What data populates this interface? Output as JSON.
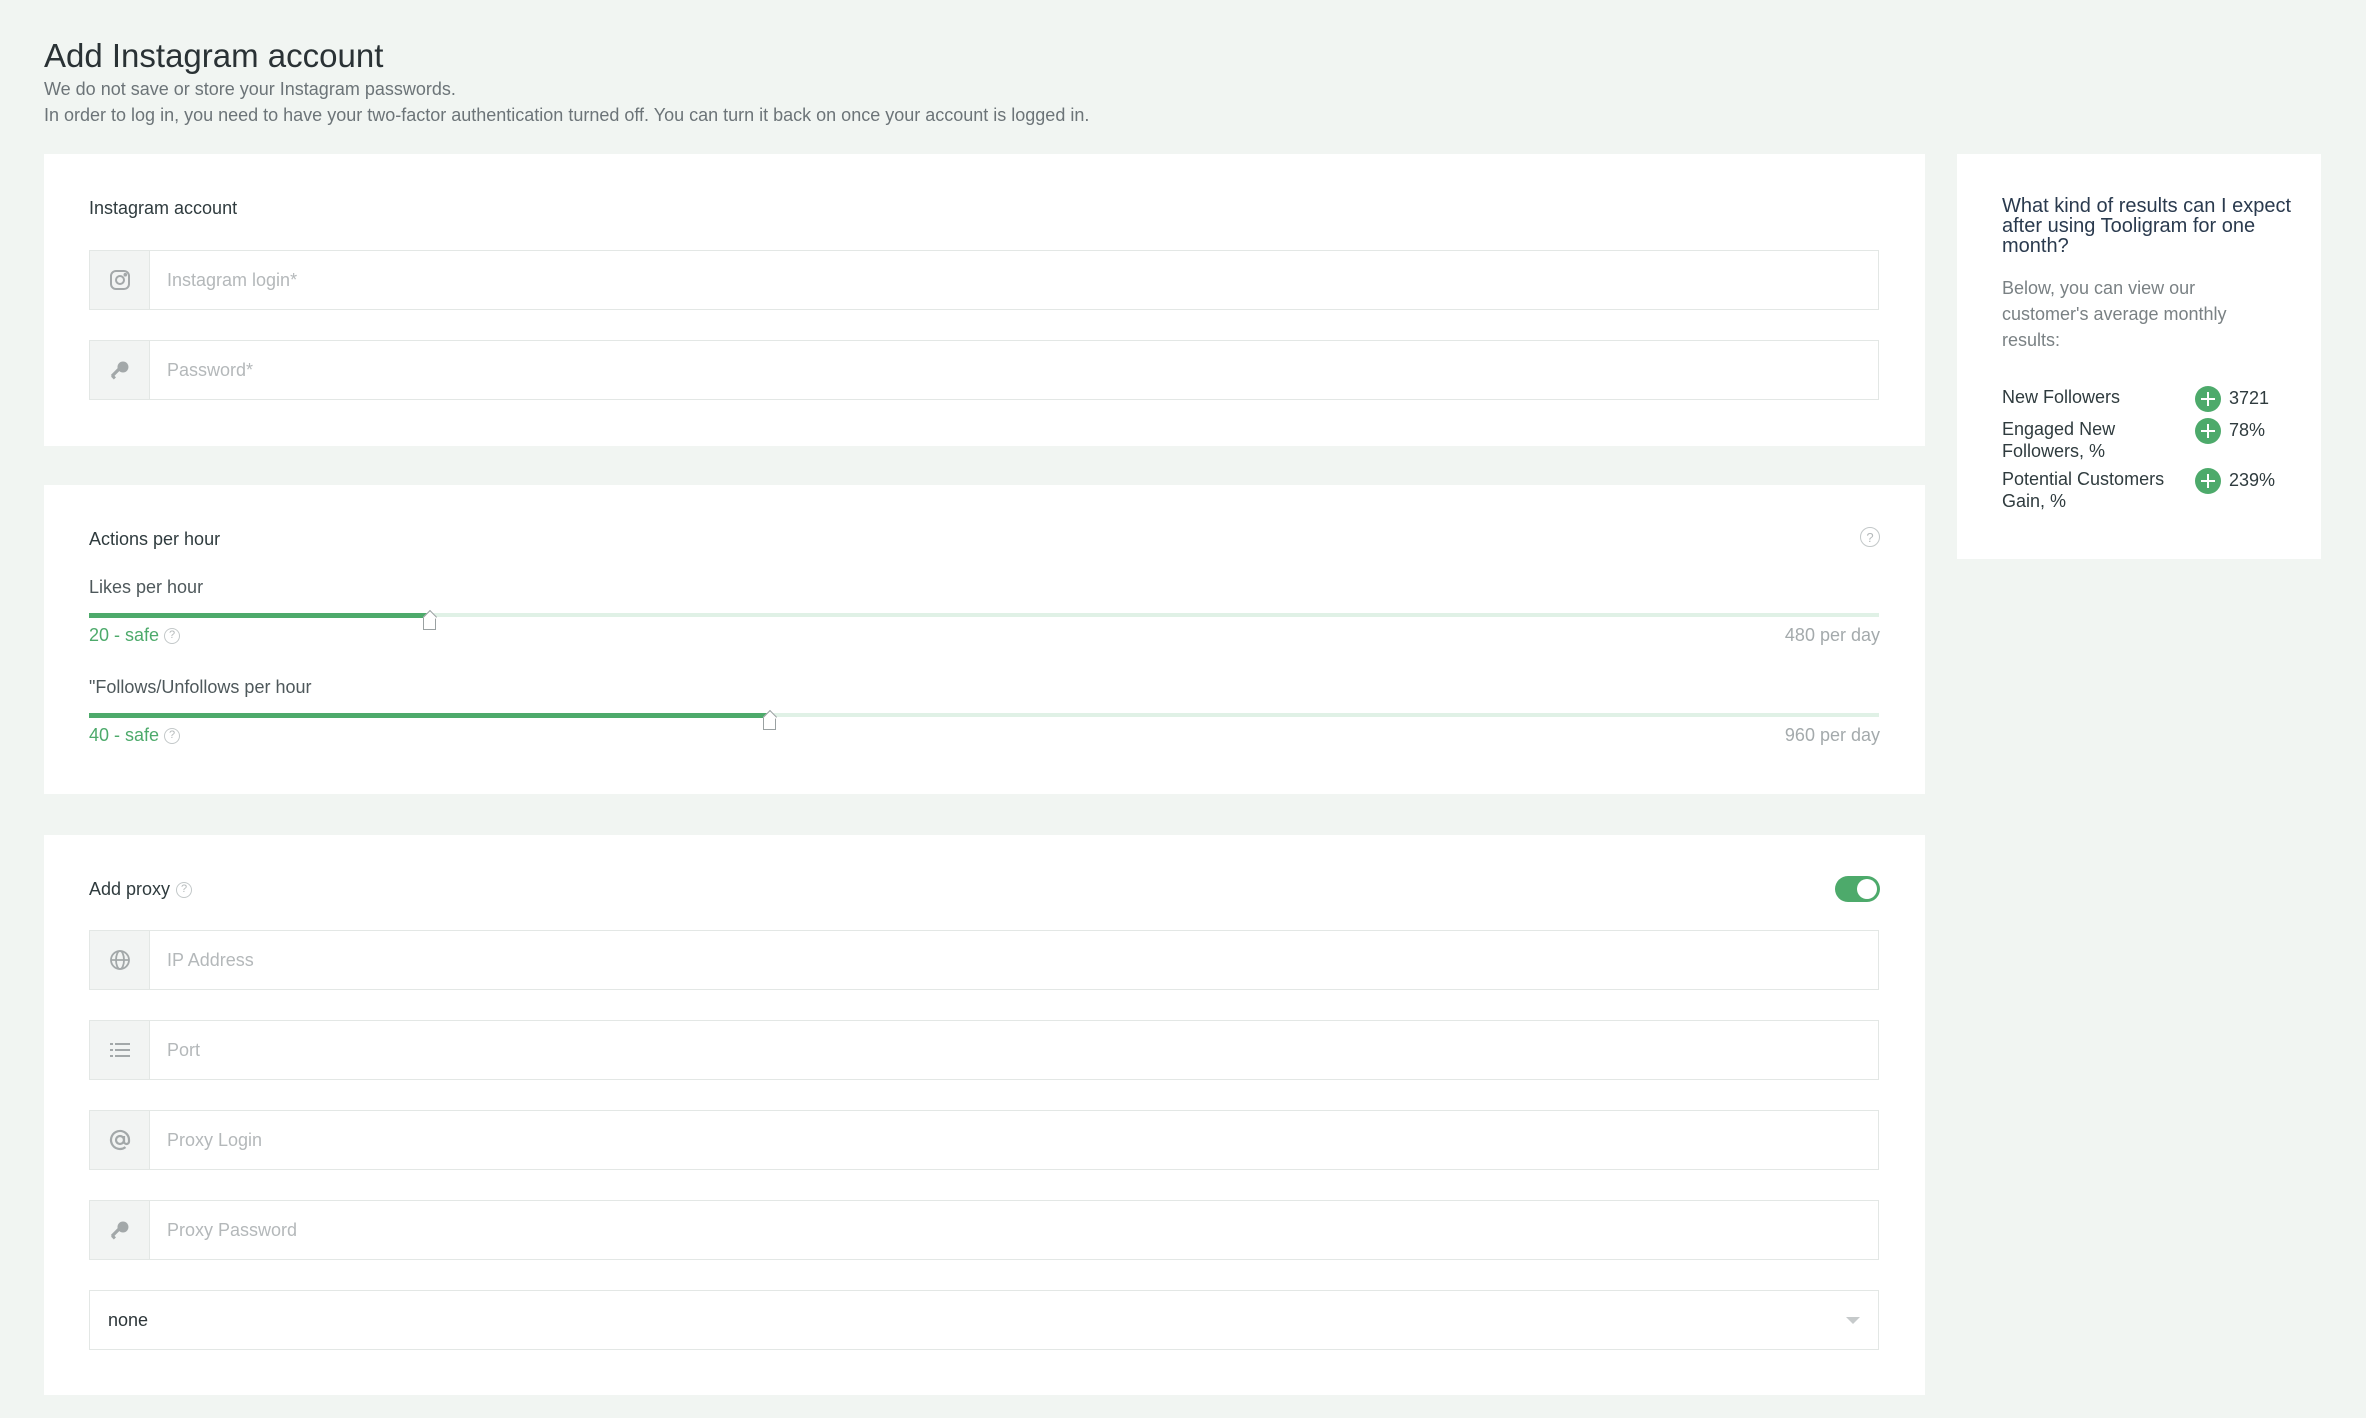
{
  "header": {
    "title": "Add Instagram account",
    "line1": "We do not save or store your Instagram passwords.",
    "line2": "In order to log in, you need to have your two-factor authentication turned off. You can turn it back on once your account is logged in."
  },
  "account": {
    "title": "Instagram account",
    "login_placeholder": "Instagram login*",
    "password_placeholder": "Password*"
  },
  "actions": {
    "title": "Actions per hour",
    "likes": {
      "label": "Likes per hour",
      "value_text": "20 - safe",
      "per_day": "480 per day",
      "fraction": 0.19
    },
    "follows": {
      "label": "\"Follows/Unfollows per hour",
      "value_text": "40 - safe",
      "per_day": "960 per day",
      "fraction": 0.38
    }
  },
  "proxy": {
    "title": "Add proxy",
    "enabled": true,
    "ip_placeholder": "IP Address",
    "port_placeholder": "Port",
    "login_placeholder": "Proxy Login",
    "password_placeholder": "Proxy Password",
    "select_value": "none"
  },
  "sidebar": {
    "title": "What kind of results can I expect after using Tooligram for one month?",
    "description": "Below, you can view our customer's average monthly results:",
    "stats": [
      {
        "name": "New Followers",
        "value": "3721"
      },
      {
        "name": "Engaged New Followers, %",
        "value": "78%"
      },
      {
        "name": "Potential Customers Gain, %",
        "value": "239%"
      }
    ]
  },
  "colors": {
    "accent": "#4daa6b",
    "background": "#f1f5f2"
  },
  "icons": [
    "instagram-icon",
    "key-icon",
    "globe-icon",
    "list-icon",
    "at-icon",
    "question-icon",
    "plus-icon",
    "chevron-down-icon"
  ]
}
